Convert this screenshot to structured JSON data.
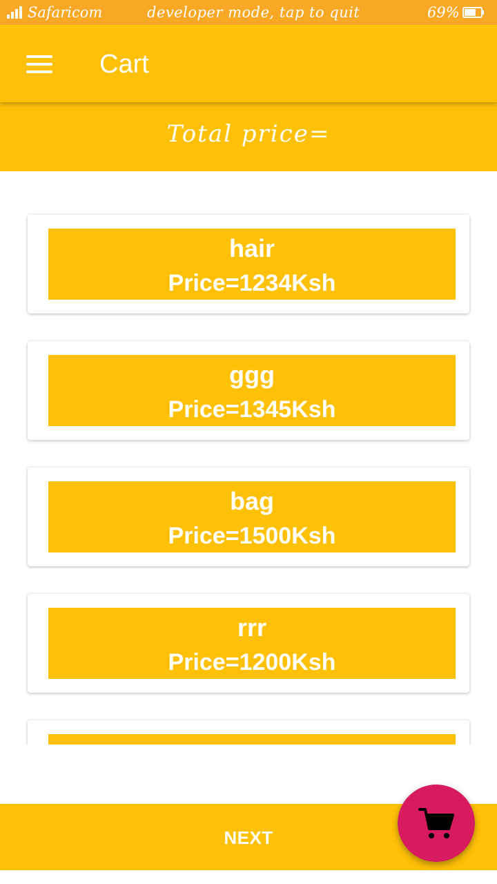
{
  "status_bar": {
    "carrier": "Safaricom",
    "message": "developer mode, tap to quit",
    "battery_percent": "69%",
    "battery_level": 0.69
  },
  "app_bar": {
    "title": "Cart",
    "menu_icon": "hamburger-menu-icon"
  },
  "summary": {
    "total_label": "Total price="
  },
  "cart_items": [
    {
      "name": "hair",
      "price": "Price=1234Ksh"
    },
    {
      "name": "ggg",
      "price": "Price=1345Ksh"
    },
    {
      "name": "bag",
      "price": "Price=1500Ksh"
    },
    {
      "name": "rrr",
      "price": "Price=1200Ksh"
    },
    {
      "name": "",
      "price": ""
    }
  ],
  "footer": {
    "next_label": "NEXT"
  },
  "fab": {
    "icon": "shopping-cart-icon"
  },
  "colors": {
    "primary": "#FFC107",
    "status_bar": "#F9A825",
    "accent": "#D81B60"
  }
}
